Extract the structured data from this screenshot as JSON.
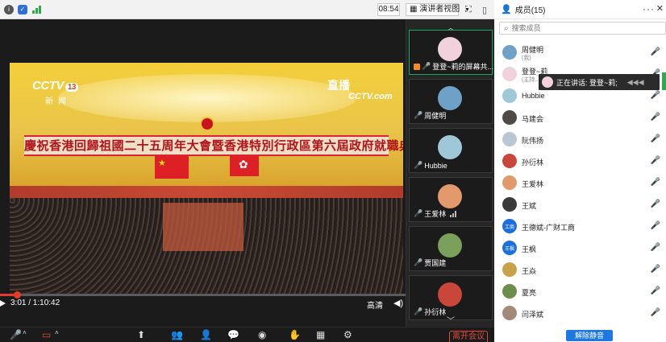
{
  "topbar": {
    "time": "08:54",
    "view_label": "演讲者视图"
  },
  "video": {
    "channel_logo": "CCTV",
    "channel_number": "13",
    "channel_sub": "新闻",
    "live_label": "直播",
    "live_sub": "CCTV.com",
    "banner_text": "慶祝香港回歸祖國二十五周年大會暨香港特別行政區第六屆政府就職典禮",
    "time_current": "3:01",
    "time_total": "1:10:42",
    "time_display": "3:01 / 1:10:42",
    "progress_fraction": 0.042,
    "quality_label": "高清"
  },
  "toolbar": {
    "leave_label": "离开会议"
  },
  "thumbnails": [
    {
      "label": "登登~莉的屏幕共...",
      "active": true,
      "avatar_color": "#f1d2dc"
    },
    {
      "label": "周健明",
      "active": false,
      "avatar_color": "#6fa0c8"
    },
    {
      "label": "Hubbie",
      "active": false,
      "avatar_color": "#9ec7d8"
    },
    {
      "label": "王爱林",
      "active": false,
      "avatar_color": "#e29a6d"
    },
    {
      "label": "贾国建",
      "active": false,
      "avatar_color": "#7aa05c"
    },
    {
      "label": "孙衍林",
      "active": false,
      "avatar_color": "#c9463a"
    }
  ],
  "panel": {
    "title": "成员(15)",
    "search_placeholder": "搜索成员",
    "speaking_text": "正在讲话: 登登~莉;",
    "unmute_all_label": "解除静音",
    "members": [
      {
        "name": "周健明",
        "sub": "(我)",
        "avatar_color": "#6fa0c8"
      },
      {
        "name": "登登~莉",
        "sub": "(主持...",
        "avatar_color": "#f1d2dc"
      },
      {
        "name": "Hubbie",
        "sub": "",
        "avatar_color": "#9ec7d8"
      },
      {
        "name": "马建会",
        "sub": "",
        "avatar_color": "#4f4a45"
      },
      {
        "name": "阮伟扬",
        "sub": "",
        "avatar_color": "#b8c7d3"
      },
      {
        "name": "孙衍林",
        "sub": "",
        "avatar_color": "#c9463a"
      },
      {
        "name": "王爱林",
        "sub": "",
        "avatar_color": "#e29a6d"
      },
      {
        "name": "王斌",
        "sub": "",
        "avatar_color": "#3a3a3a"
      },
      {
        "name": "王德斌-广财工商",
        "sub": "",
        "avatar_color": "#1e6fd9",
        "tag": "工商"
      },
      {
        "name": "王枫",
        "sub": "",
        "avatar_color": "#1e6fd9",
        "tag": "王枫"
      },
      {
        "name": "王焱",
        "sub": "",
        "avatar_color": "#c8a24a"
      },
      {
        "name": "夏亮",
        "sub": "",
        "avatar_color": "#6c8e4b"
      },
      {
        "name": "闫泽斌",
        "sub": "",
        "avatar_color": "#a3897a"
      }
    ]
  }
}
